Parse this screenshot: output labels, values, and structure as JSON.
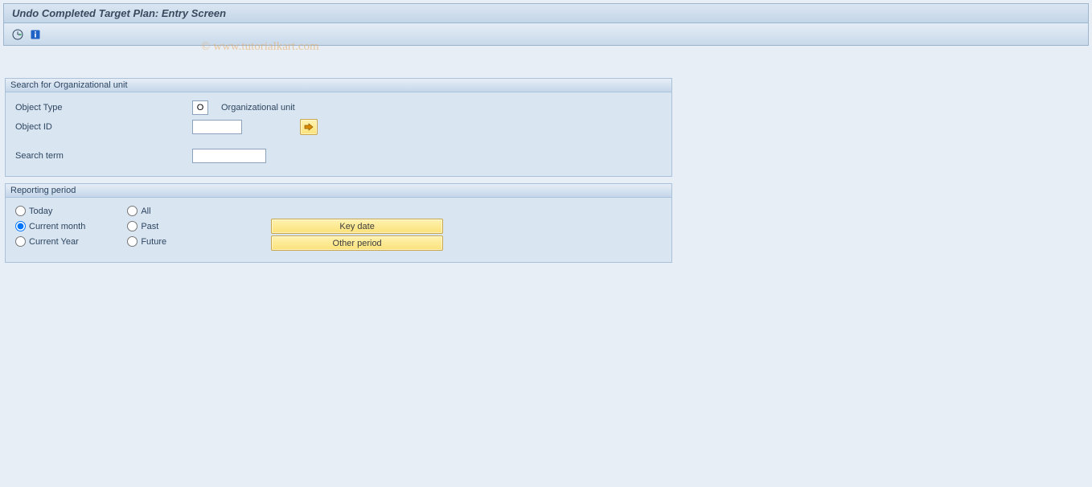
{
  "titlebar": {
    "title": "Undo Completed Target Plan: Entry Screen"
  },
  "watermark": "© www.tutorialkart.com",
  "toolbar": {
    "icons": {
      "execute": "execute-icon",
      "info": "info-icon"
    }
  },
  "search_box": {
    "legend": "Search for Organizational unit",
    "object_type_label": "Object Type",
    "object_type_value": "O",
    "object_type_desc": "Organizational unit",
    "object_id_label": "Object ID",
    "object_id_value": "",
    "search_term_label": "Search term",
    "search_term_value": ""
  },
  "period_box": {
    "legend": "Reporting period",
    "col1": [
      {
        "label": "Today",
        "checked": false
      },
      {
        "label": "Current month",
        "checked": true
      },
      {
        "label": "Current Year",
        "checked": false
      }
    ],
    "col2": [
      {
        "label": "All",
        "checked": false
      },
      {
        "label": "Past",
        "checked": false
      },
      {
        "label": "Future",
        "checked": false
      }
    ],
    "buttons": {
      "key_date": "Key date",
      "other_period": "Other period"
    }
  }
}
